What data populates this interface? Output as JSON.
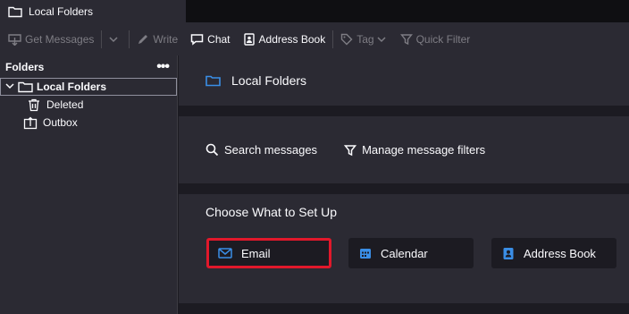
{
  "tab": {
    "title": "Local Folders",
    "icon": "folder-icon"
  },
  "toolbar": {
    "get_messages": "Get Messages",
    "write": "Write",
    "chat": "Chat",
    "address_book": "Address Book",
    "tag": "Tag",
    "quick_filter": "Quick Filter"
  },
  "folder_pane": {
    "header": "Folders",
    "more": "•••",
    "items": [
      {
        "label": "Local Folders",
        "icon": "folder-icon",
        "selected": true
      },
      {
        "label": "Deleted",
        "icon": "trash-icon"
      },
      {
        "label": "Outbox",
        "icon": "outbox-icon"
      }
    ]
  },
  "main": {
    "title": "Local Folders",
    "search_messages": "Search messages",
    "manage_filters": "Manage message filters",
    "setup_title": "Choose What to Set Up",
    "setup_buttons": {
      "email": "Email",
      "calendar": "Calendar",
      "address_book": "Address Book"
    }
  },
  "colors": {
    "accent": "#3a8ee6",
    "highlight": "#e1182b",
    "panel": "#2b2a33",
    "background": "#1c1b22"
  }
}
